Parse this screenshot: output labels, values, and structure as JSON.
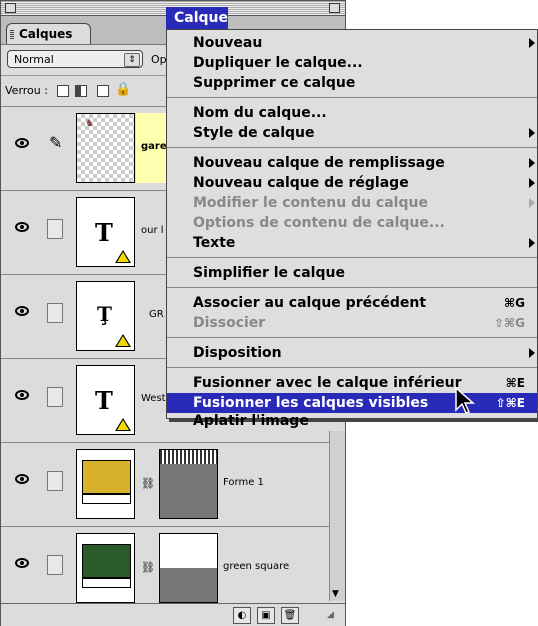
{
  "panel": {
    "tab_label": "Calques",
    "blend_mode": "Normal",
    "opacity_label": "Op",
    "lock_label": "Verrou :",
    "layers": [
      {
        "name": "gare",
        "selected": true
      },
      {
        "name": "our l"
      },
      {
        "name": "GR"
      },
      {
        "name": "West"
      },
      {
        "name": "Forme 1",
        "color": "#d8b22a"
      },
      {
        "name": "green square",
        "color": "#2b5a2b"
      }
    ]
  },
  "menu": {
    "title": "Calque",
    "items": [
      {
        "label": "Nouveau",
        "submenu": true
      },
      {
        "label": "Dupliquer le calque..."
      },
      {
        "label": "Supprimer ce calque"
      },
      {
        "label": "Nom du calque..."
      },
      {
        "label": "Style de calque",
        "submenu": true
      },
      {
        "label": "Nouveau calque de remplissage",
        "submenu": true
      },
      {
        "label": "Nouveau calque de réglage",
        "submenu": true
      },
      {
        "label": "Modifier le contenu du calque",
        "submenu": true,
        "disabled": true
      },
      {
        "label": "Options de contenu de calque...",
        "disabled": true
      },
      {
        "label": "Texte",
        "submenu": true
      },
      {
        "label": "Simplifier le calque"
      },
      {
        "label": "Associer au calque précédent",
        "shortcut": "⌘G"
      },
      {
        "label": "Dissocier",
        "shortcut": "⇧⌘G",
        "disabled": true
      },
      {
        "label": "Disposition",
        "submenu": true
      },
      {
        "label": "Fusionner avec le calque inférieur",
        "shortcut": "⌘E"
      },
      {
        "label": "Fusionner les calques visibles",
        "shortcut": "⇧⌘E",
        "highlighted": true
      },
      {
        "label": "Aplatir l'image"
      }
    ]
  }
}
